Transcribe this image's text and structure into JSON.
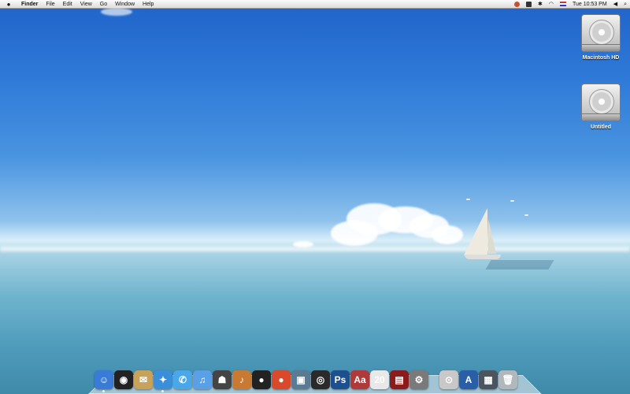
{
  "menubar": {
    "apple_icon": "apple-icon",
    "items": [
      {
        "label": "Finder",
        "bold": true
      },
      {
        "label": "File"
      },
      {
        "label": "Edit"
      },
      {
        "label": "View"
      },
      {
        "label": "Go"
      },
      {
        "label": "Window"
      },
      {
        "label": "Help"
      }
    ],
    "clock": "Tue 10:53 PM",
    "status_icons": [
      "app-status-icon",
      "number-one-icon",
      "bluetooth-icon",
      "wifi-icon",
      "us-flag-icon",
      "volume-icon",
      "spotlight-icon"
    ]
  },
  "desktop": {
    "icons": [
      {
        "label": "Macintosh HD",
        "icon": "hard-disk-icon"
      },
      {
        "label": "Untitled",
        "icon": "hard-disk-icon"
      }
    ]
  },
  "dock": {
    "items": [
      {
        "name": "finder",
        "glyph": "☺",
        "color": "#3a7bd5",
        "running": true
      },
      {
        "name": "dashboard",
        "glyph": "◉",
        "color": "#222222"
      },
      {
        "name": "mail",
        "glyph": "✉",
        "color": "#c9a25a"
      },
      {
        "name": "safari",
        "glyph": "✦",
        "color": "#3b8fd8",
        "running": true
      },
      {
        "name": "ichat",
        "glyph": "✆",
        "color": "#4aa8e8"
      },
      {
        "name": "itunes",
        "glyph": "♫",
        "color": "#5aa0e6"
      },
      {
        "name": "front-row",
        "glyph": "☗",
        "color": "#444444"
      },
      {
        "name": "garageband",
        "glyph": "♪",
        "color": "#c97a32"
      },
      {
        "name": "qq",
        "glyph": "●",
        "color": "#222222"
      },
      {
        "name": "qq-alt",
        "glyph": "●",
        "color": "#d94a2a"
      },
      {
        "name": "iphoto",
        "glyph": "▣",
        "color": "#5b7a94"
      },
      {
        "name": "camera",
        "glyph": "◎",
        "color": "#2a2a2a"
      },
      {
        "name": "photoshop",
        "glyph": "Ps",
        "color": "#1e4f8f"
      },
      {
        "name": "dictionary",
        "glyph": "Aa",
        "color": "#b03a3a"
      },
      {
        "name": "ical",
        "glyph": "20",
        "color": "#e8e8e8"
      },
      {
        "name": "photo-booth",
        "glyph": "▤",
        "color": "#8c1c1c"
      },
      {
        "name": "system-preferences",
        "glyph": "⚙",
        "color": "#7a7a7a"
      },
      {
        "name": "separator"
      },
      {
        "name": "downloads",
        "glyph": "⊙",
        "color": "#c8c8c8"
      },
      {
        "name": "applications",
        "glyph": "A",
        "color": "#2a5fa8"
      },
      {
        "name": "documents",
        "glyph": "▦",
        "color": "#4a5560"
      },
      {
        "name": "trash",
        "glyph": "🗑",
        "color": "#b0b8bc"
      }
    ]
  }
}
